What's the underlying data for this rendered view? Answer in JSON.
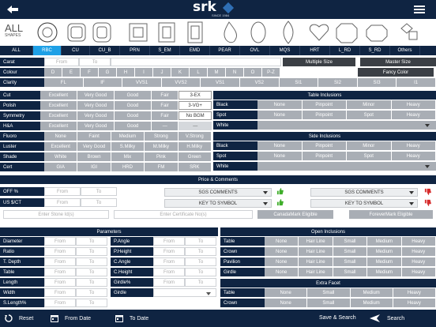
{
  "header": {
    "logo_text": "srk",
    "logo_sub": "SINCE 1984"
  },
  "shapes": {
    "all_label": "ALL",
    "all_sub": "SHAPES",
    "tabs": [
      "ALL",
      "RBC",
      "CU",
      "CU_B",
      "PRN",
      "S_EM",
      "EMD",
      "PEAR",
      "OVL",
      "MQS",
      "HRT",
      "L_RD",
      "S_RD",
      "Others"
    ],
    "selected": "RBC"
  },
  "carat": {
    "label": "Carat",
    "from": "From",
    "to": "To",
    "multiple_size": "Multiple Size",
    "master_size": "Master Size"
  },
  "colour": {
    "label": "Colour",
    "items": [
      "D",
      "E",
      "F",
      "G",
      "H",
      "I",
      "J",
      "K",
      "L",
      "M",
      "N",
      "O",
      "P-Z"
    ],
    "fancy": "Fancy Color"
  },
  "clarity": {
    "label": "Clarity",
    "items": [
      "FL",
      "IF",
      "VVS1",
      "VVS2",
      "VS1",
      "VS2",
      "SI1",
      "SI2",
      "SI3",
      "I1"
    ]
  },
  "cut": {
    "label": "Cut",
    "items": [
      "Excellent",
      "Very Good",
      "Good",
      "Fair"
    ],
    "extra": "3-EX"
  },
  "polish": {
    "label": "Polish",
    "items": [
      "Excellent",
      "Very Good",
      "Good",
      "Fair"
    ],
    "extra": "3-VG+"
  },
  "symmetry": {
    "label": "Symmetry",
    "items": [
      "Excellent",
      "Very Good",
      "Good",
      "Fair"
    ],
    "extra": "No BGM"
  },
  "ha": {
    "label": "H&A",
    "items": [
      "Excellent",
      "Very Good",
      "Good",
      "—"
    ],
    "extra": "—"
  },
  "fluoro": {
    "label": "Fluoro",
    "items": [
      "None",
      "Faint",
      "Medium",
      "Strong",
      "V.Strong"
    ]
  },
  "luster": {
    "label": "Luster",
    "items": [
      "Excellent",
      "Very Good",
      "S.Milky",
      "M.Milky",
      "H.Milky"
    ]
  },
  "shade": {
    "label": "Shade",
    "items": [
      "White",
      "Brown",
      "Mix",
      "Pink",
      "Green"
    ]
  },
  "cert": {
    "label": "Cert",
    "items": [
      "GIA",
      "IGI",
      "HRD",
      "FM",
      "SRK"
    ]
  },
  "table_inclusions": {
    "title": "Table Inclusions",
    "rows": [
      {
        "label": "Black",
        "items": [
          "None",
          "Pinpoint",
          "Minor",
          "Heavy"
        ]
      },
      {
        "label": "Spot",
        "items": [
          "None",
          "Pinpoint",
          "Spot",
          "Heavy"
        ]
      },
      {
        "label": "White",
        "items": []
      }
    ]
  },
  "side_inclusions": {
    "title": "Side Inclusions",
    "rows": [
      {
        "label": "Black",
        "items": [
          "None",
          "Pinpoint",
          "Minor",
          "Heavy"
        ]
      },
      {
        "label": "Spot",
        "items": [
          "None",
          "Pinpoint",
          "Spot",
          "Heavy"
        ]
      },
      {
        "label": "White",
        "items": []
      }
    ]
  },
  "price": {
    "title": "Price & Comments",
    "off": {
      "label": "OFF %",
      "from": "From",
      "to": "To"
    },
    "usct": {
      "label": "US $/CT",
      "from": "From",
      "to": "To"
    },
    "sgs1": "SGS COMMENTS",
    "key1": "KEY TO SYMBOL",
    "sgs2": "SGS COMMENTS",
    "key2": "KEY TO SYMBOL",
    "stone_placeholder": "Enter Stone Id(s)",
    "cert_placeholder": "Enter Certificate No(s)",
    "canada": "CanadaMark Eligible",
    "forever": "ForeverMark Eligible"
  },
  "parameters": {
    "title": "Parameters",
    "left": [
      "Diameter",
      "Ratio",
      "T. Depth",
      "Table",
      "Length",
      "Width",
      "S.Length%"
    ],
    "right": [
      "P.Angle",
      "P.Height",
      "C.Angle",
      "C.Height",
      "Girdle%",
      "Girdle"
    ],
    "from": "From",
    "to": "To"
  },
  "open_inclusions": {
    "title": "Open Inclusions",
    "rows": [
      "Table",
      "Crown",
      "Pavilion",
      "Girdle"
    ],
    "items": [
      "None",
      "Hair Line",
      "Small",
      "Medium",
      "Heavy"
    ]
  },
  "extra_facet": {
    "title": "Extra Facet",
    "rows": [
      "Table",
      "Crown"
    ],
    "items": [
      "None",
      "Small",
      "Medium",
      "Heavy"
    ]
  },
  "footer": {
    "reset": "Reset",
    "from_date": "From Date",
    "to_date": "To Date",
    "save_search": "Save & Search",
    "search": "Search"
  },
  "colors": {
    "navy": "#0f2442",
    "grey": "#a9aeb5",
    "selected": "#1ea0e6",
    "like": "#3fae2a",
    "dislike": "#d62b2b"
  }
}
